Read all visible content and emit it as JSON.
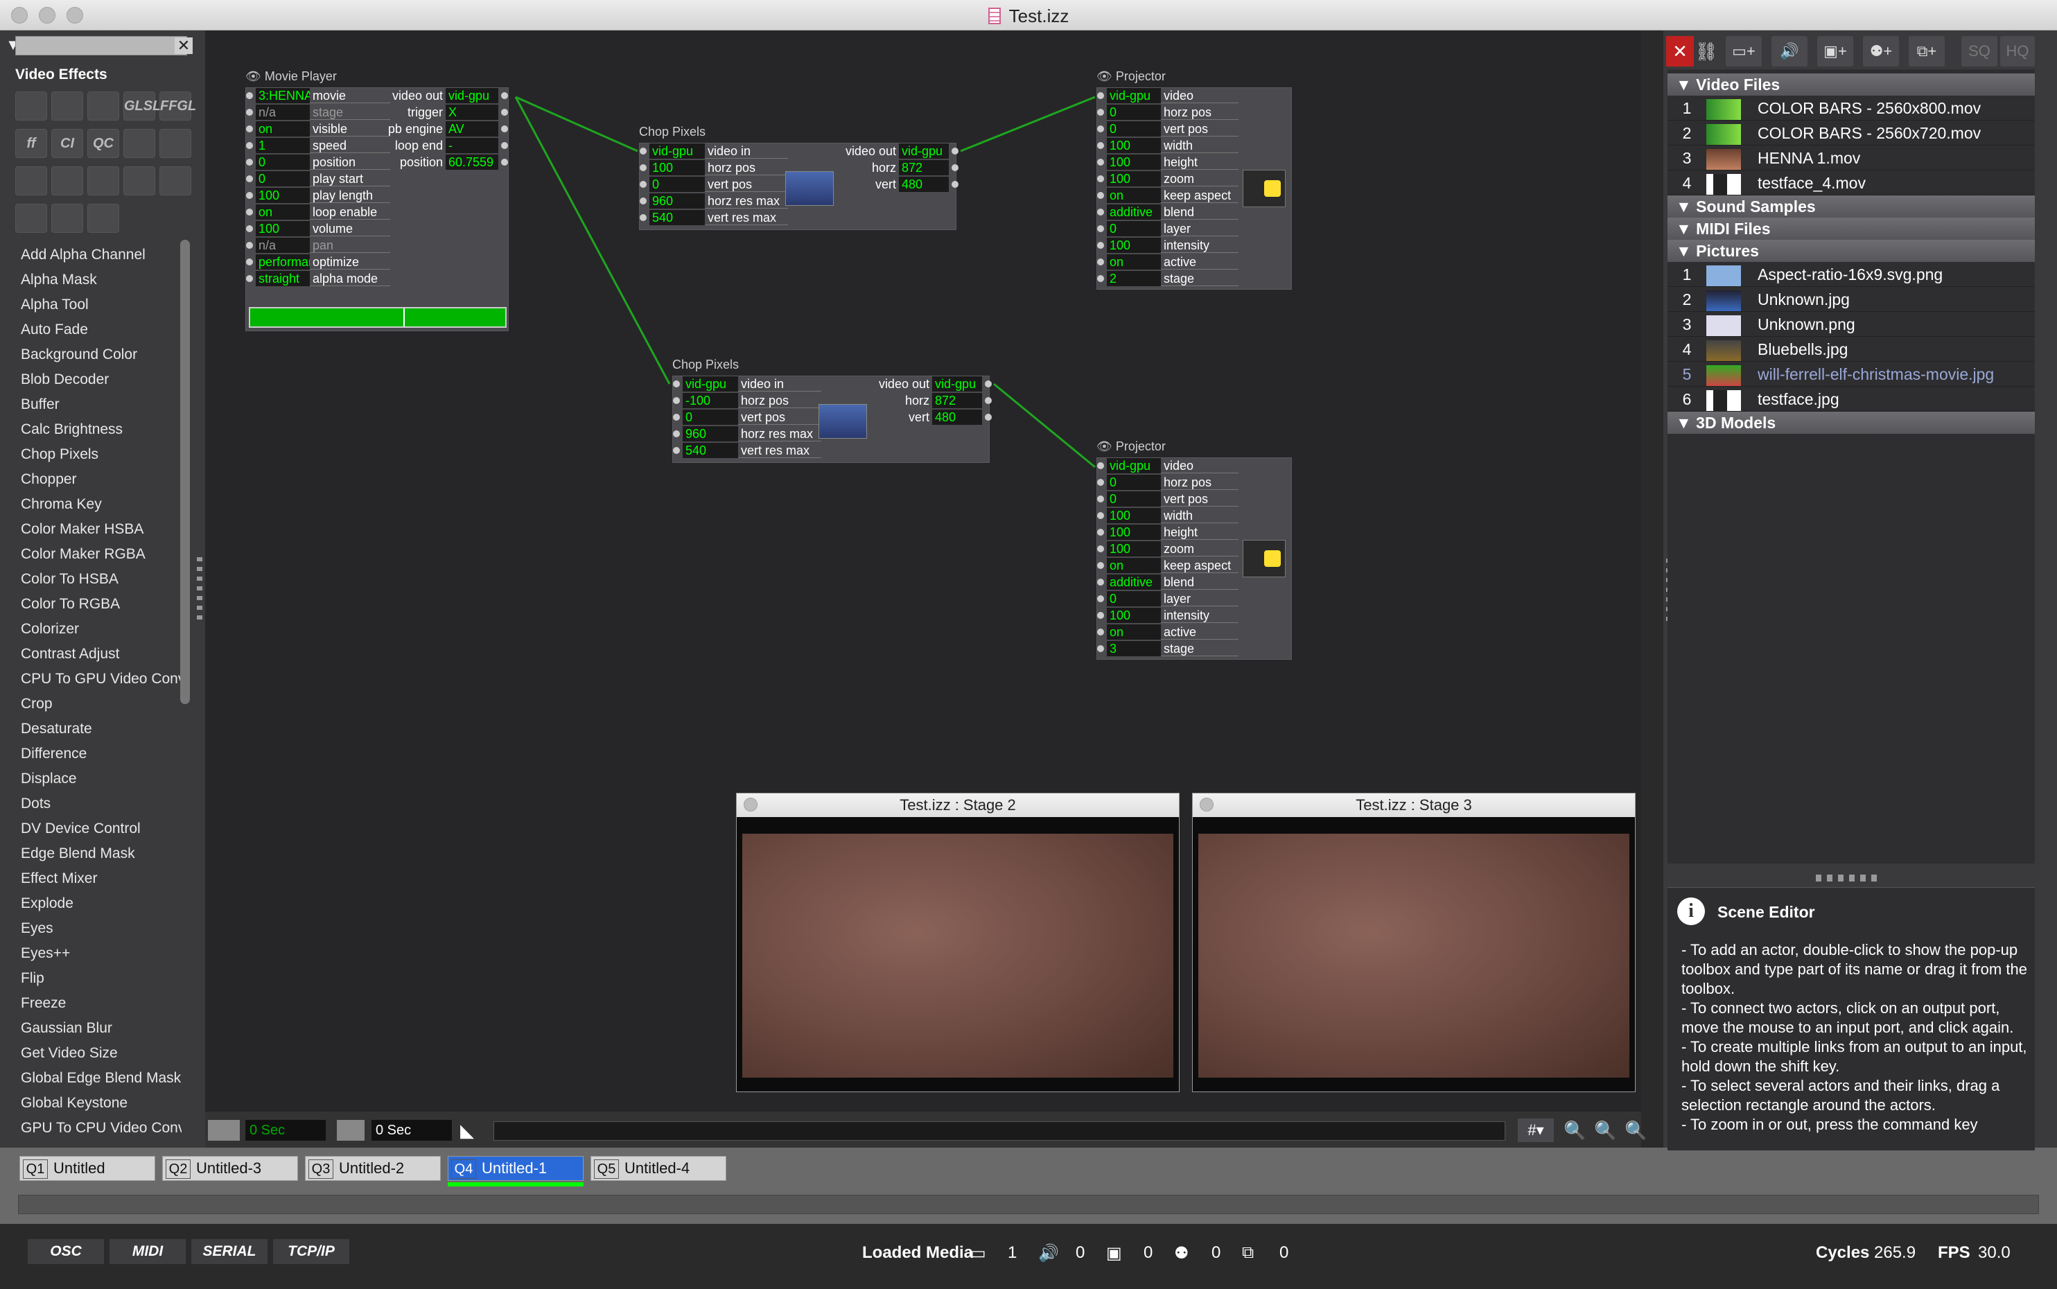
{
  "window": {
    "title": "Test.izz"
  },
  "toolbox": {
    "category": "Video Effects",
    "search_placeholder": "",
    "tool_icons": [
      "rect-frame",
      "arrow-in",
      "arrow-out",
      "GLSL",
      "FFGL",
      "ff",
      "CI",
      "QC",
      "speaker",
      "palette",
      "wave",
      "hand",
      "slider",
      "gear",
      "windows",
      "antenna",
      "person",
      "heart"
    ],
    "actors": [
      "Add Alpha Channel",
      "Alpha Mask",
      "Alpha Tool",
      "Auto Fade",
      "Background Color",
      "Blob Decoder",
      "Buffer",
      "Calc Brightness",
      "Chop Pixels",
      "Chopper",
      "Chroma Key",
      "Color Maker HSBA",
      "Color Maker RGBA",
      "Color To HSBA",
      "Color To RGBA",
      "Colorizer",
      "Contrast Adjust",
      "CPU To GPU Video Converter",
      "Crop",
      "Desaturate",
      "Difference",
      "Displace",
      "Dots",
      "DV Device Control",
      "Edge Blend Mask",
      "Effect Mixer",
      "Explode",
      "Eyes",
      "Eyes++",
      "Flip",
      "Freeze",
      "Gaussian Blur",
      "Get Video Size",
      "Global Edge Blend Mask",
      "Global Keystone",
      "GPU To CPU Video Converter"
    ]
  },
  "movie_player": {
    "name": "Movie Player",
    "inputs": [
      [
        "3:HENNA",
        "movie"
      ],
      [
        "n/a",
        "stage"
      ],
      [
        "on",
        "visible"
      ],
      [
        "1",
        "speed"
      ],
      [
        "0",
        "position"
      ],
      [
        "0",
        "play start"
      ],
      [
        "100",
        "play length"
      ],
      [
        "on",
        "loop enable"
      ],
      [
        "100",
        "volume"
      ],
      [
        "n/a",
        "pan"
      ],
      [
        "performance",
        "optimize"
      ],
      [
        "straight",
        "alpha mode"
      ]
    ],
    "outputs": [
      [
        "video out",
        "vid-gpu"
      ],
      [
        "trigger",
        "X"
      ],
      [
        "pb engine",
        "AV"
      ],
      [
        "loop end",
        "-"
      ],
      [
        "position",
        "60.7559"
      ]
    ],
    "progress": 0.6
  },
  "chop1": {
    "name": "Chop Pixels",
    "inputs": [
      [
        "vid-gpu",
        "video in"
      ],
      [
        "100",
        "horz pos"
      ],
      [
        "0",
        "vert pos"
      ],
      [
        "960",
        "horz res max"
      ],
      [
        "540",
        "vert res max"
      ]
    ],
    "outputs": [
      [
        "video out",
        "vid-gpu"
      ],
      [
        "horz",
        "872"
      ],
      [
        "vert",
        "480"
      ]
    ]
  },
  "chop2": {
    "name": "Chop Pixels",
    "inputs": [
      [
        "vid-gpu",
        "video in"
      ],
      [
        "-100",
        "horz pos"
      ],
      [
        "0",
        "vert pos"
      ],
      [
        "960",
        "horz res max"
      ],
      [
        "540",
        "vert res max"
      ]
    ],
    "outputs": [
      [
        "video out",
        "vid-gpu"
      ],
      [
        "horz",
        "872"
      ],
      [
        "vert",
        "480"
      ]
    ]
  },
  "projector1": {
    "name": "Projector",
    "inputs": [
      [
        "vid-gpu",
        "video"
      ],
      [
        "0",
        "horz pos"
      ],
      [
        "0",
        "vert pos"
      ],
      [
        "100",
        "width"
      ],
      [
        "100",
        "height"
      ],
      [
        "100",
        "zoom"
      ],
      [
        "on",
        "keep aspect"
      ],
      [
        "additive",
        "blend"
      ],
      [
        "0",
        "layer"
      ],
      [
        "100",
        "intensity"
      ],
      [
        "on",
        "active"
      ],
      [
        "2",
        "stage"
      ]
    ]
  },
  "projector2": {
    "name": "Projector",
    "inputs": [
      [
        "vid-gpu",
        "video"
      ],
      [
        "0",
        "horz pos"
      ],
      [
        "0",
        "vert pos"
      ],
      [
        "100",
        "width"
      ],
      [
        "100",
        "height"
      ],
      [
        "100",
        "zoom"
      ],
      [
        "on",
        "keep aspect"
      ],
      [
        "additive",
        "blend"
      ],
      [
        "0",
        "layer"
      ],
      [
        "100",
        "intensity"
      ],
      [
        "on",
        "active"
      ],
      [
        "3",
        "stage"
      ]
    ]
  },
  "stages": [
    {
      "title": "Test.izz : Stage 2"
    },
    {
      "title": "Test.izz : Stage 3"
    }
  ],
  "timebar": {
    "left_time": "0 Sec",
    "right_time": "0 Sec",
    "grid": "#"
  },
  "scenes": [
    {
      "q": "Q1",
      "name": "Untitled"
    },
    {
      "q": "Q2",
      "name": "Untitled-3"
    },
    {
      "q": "Q3",
      "name": "Untitled-2"
    },
    {
      "q": "Q4",
      "name": "Untitled-1"
    },
    {
      "q": "Q5",
      "name": "Untitled-4"
    }
  ],
  "status": {
    "buttons": [
      "OSC",
      "MIDI",
      "SERIAL",
      "TCP/IP"
    ],
    "loaded_media_label": "Loaded Media",
    "counts": [
      "1",
      "0",
      "0",
      "0",
      "0"
    ],
    "cycles_label": "Cycles",
    "cycles": "265.9",
    "fps_label": "FPS",
    "fps": "30.0"
  },
  "media": {
    "groups": [
      {
        "name": "Video Files",
        "items": [
          [
            "1",
            "COLOR BARS - 2560x800.mov"
          ],
          [
            "2",
            "COLOR BARS - 2560x720.mov"
          ],
          [
            "3",
            "HENNA 1.mov"
          ],
          [
            "4",
            "testface_4.mov"
          ]
        ]
      },
      {
        "name": "Sound Samples",
        "items": []
      },
      {
        "name": "MIDI Files",
        "items": []
      },
      {
        "name": "Pictures",
        "items": [
          [
            "1",
            "Aspect-ratio-16x9.svg.png"
          ],
          [
            "2",
            "Unknown.jpg"
          ],
          [
            "3",
            "Unknown.png"
          ],
          [
            "4",
            "Bluebells.jpg"
          ],
          [
            "5",
            "will-ferrell-elf-christmas-movie.jpg"
          ],
          [
            "6",
            "testface.jpg"
          ]
        ]
      },
      {
        "name": "3D Models",
        "items": []
      }
    ]
  },
  "toolbar_right": [
    "SQ",
    "HQ"
  ],
  "help": {
    "title": "Scene Editor",
    "text": "- To add an actor, double-click to show the pop-up toolbox and type part of its name or drag it from the toolbox.\n- To connect two actors, click on an output port, move the mouse to an input port, and click again.\n- To create multiple links from an output to an input, hold down the shift key.\n- To select several actors and their links, drag a selection rectangle around the actors.\n- To zoom in or out, press the command key"
  }
}
